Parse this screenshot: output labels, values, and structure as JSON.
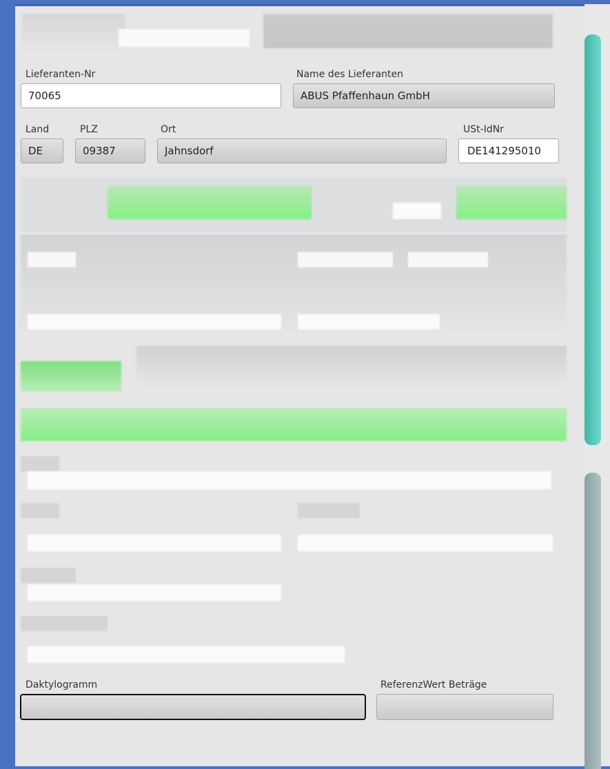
{
  "form": {
    "supplier_no_label": "Lieferanten-Nr",
    "supplier_no_value": "70065",
    "supplier_name_label": "Name des Lieferanten",
    "supplier_name_value": "ABUS Pfaffenhaun GmbH",
    "country_label": "Land",
    "country_value": "DE",
    "zip_label": "PLZ",
    "zip_value": "09387",
    "city_label": "Ort",
    "city_value": "Jahnsdorf",
    "vat_label": "USt-IdNr",
    "vat_value": "DE141295010",
    "fingerprint_label": "Daktylogramm",
    "fingerprint_value": "",
    "reference_label": "ReferenzWert Beträge",
    "reference_value": ""
  },
  "colors": {
    "background": "#4a72c4",
    "panel": "#e6e6e6",
    "highlight_green": "#86f086",
    "scrollbar_teal": "#52c8bb",
    "scrollbar_gray": "#9fb2b5"
  }
}
